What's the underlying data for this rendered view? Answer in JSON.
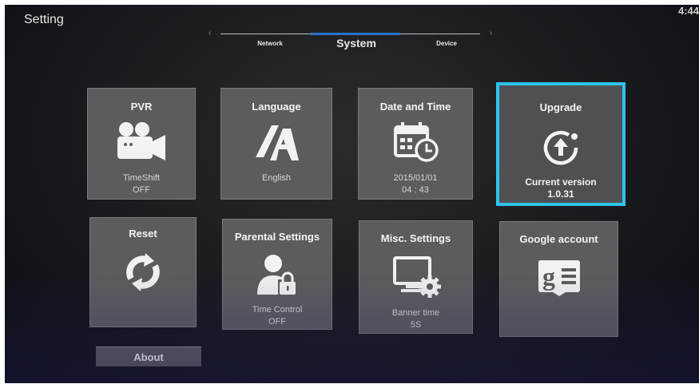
{
  "header": {
    "title": "Setting",
    "clock": "4:44"
  },
  "tabs": [
    {
      "label": "Network"
    },
    {
      "label": "System"
    },
    {
      "label": "Device"
    }
  ],
  "accent_color": "#2fc3ea",
  "tiles": {
    "pvr": {
      "title": "PVR",
      "icon": "video-camera-icon",
      "line1": "TimeShift",
      "line2": "OFF"
    },
    "language": {
      "title": "Language",
      "icon": "language-icon",
      "line1": "English"
    },
    "datetime": {
      "title": "Date and Time",
      "icon": "calendar-clock-icon",
      "line1": "2015/01/01",
      "line2": "04 : 43"
    },
    "upgrade": {
      "title": "Upgrade",
      "icon": "upgrade-arrow-icon",
      "line1": "Current version",
      "line2": "1.0.31"
    },
    "reset": {
      "title": "Reset",
      "icon": "refresh-icon"
    },
    "parental": {
      "title": "Parental Settings",
      "icon": "user-lock-icon",
      "line1": "Time Control",
      "line2": "OFF"
    },
    "misc": {
      "title": "Misc. Settings",
      "icon": "monitor-gear-icon",
      "line1": "Banner time",
      "line2": "5S"
    },
    "google": {
      "title": "Google account",
      "icon": "google-account-icon"
    }
  },
  "about": {
    "label": "About"
  }
}
